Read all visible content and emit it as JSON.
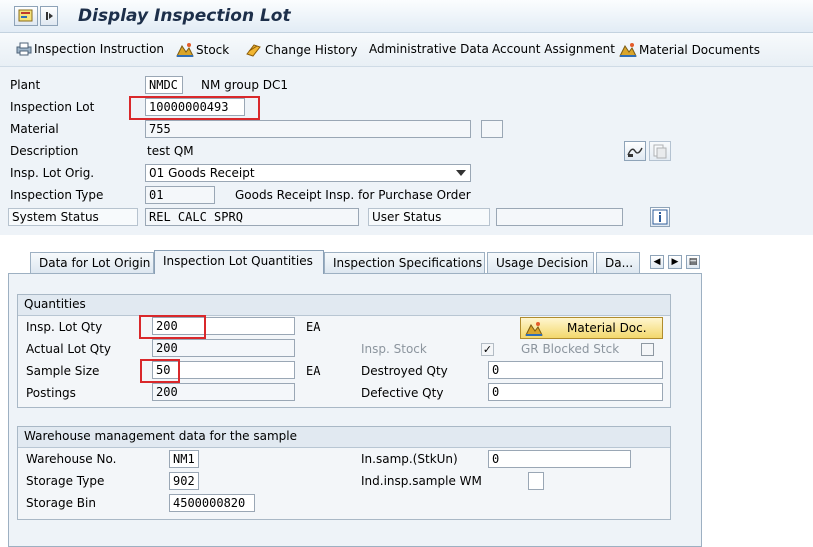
{
  "window": {
    "title": "Display Inspection Lot"
  },
  "toolbar": {
    "inspection_instruction": "Inspection Instruction",
    "stock": "Stock",
    "change_history": "Change History",
    "administrative_data": "Administrative Data",
    "account_assignment": "Account Assignment",
    "material_documents": "Material Documents"
  },
  "header": {
    "plant": {
      "label": "Plant",
      "value": "NMDC",
      "text": "NM group DC1"
    },
    "inspection_lot": {
      "label": "Inspection Lot",
      "value": "10000000493"
    },
    "material": {
      "label": "Material",
      "value": "755"
    },
    "description": {
      "label": "Description",
      "value": "test QM"
    },
    "insp_lot_orig": {
      "label": "Insp. Lot Orig.",
      "value": "01 Goods Receipt"
    },
    "inspection_type": {
      "label": "Inspection Type",
      "value": "01",
      "text": "Goods Receipt Insp. for Purchase Order"
    },
    "system_status": {
      "label": "System Status",
      "value": "REL  CALC SPRQ"
    },
    "user_status": {
      "label": "User Status",
      "value": ""
    }
  },
  "tabs": [
    {
      "label": "Data for Lot Origin"
    },
    {
      "label": "Inspection Lot Quantities"
    },
    {
      "label": "Inspection Specifications"
    },
    {
      "label": "Usage Decision"
    },
    {
      "label": "Da..."
    }
  ],
  "quantities": {
    "title": "Quantities",
    "insp_lot_qty": {
      "label": "Insp. Lot Qty",
      "value": "200",
      "unit": "EA"
    },
    "actual_lot_qty": {
      "label": "Actual Lot Qty",
      "value": "200"
    },
    "sample_size": {
      "label": "Sample Size",
      "value": "50",
      "unit": "EA"
    },
    "postings": {
      "label": "Postings",
      "value": "200"
    },
    "material_doc_button": "Material Doc.",
    "insp_stock": {
      "label": "Insp. Stock",
      "checked": true
    },
    "gr_blocked_stck": {
      "label": "GR Blocked Stck",
      "checked": false
    },
    "destroyed_qty": {
      "label": "Destroyed Qty",
      "value": "0"
    },
    "defective_qty": {
      "label": "Defective Qty",
      "value": "0"
    }
  },
  "warehouse": {
    "title": "Warehouse management data for the sample",
    "warehouse_no": {
      "label": "Warehouse No.",
      "value": "NM1"
    },
    "storage_type": {
      "label": "Storage Type",
      "value": "902"
    },
    "storage_bin": {
      "label": "Storage Bin",
      "value": "4500000820"
    },
    "in_samp": {
      "label": "In.samp.(StkUn)",
      "value": "0"
    },
    "ind_insp_sample_wm": {
      "label": "Ind.insp.sample WM",
      "checked": false
    }
  },
  "colors": {
    "highlight": "#d9282b",
    "panel": "#eef3f8",
    "button": "#f3d86d"
  }
}
